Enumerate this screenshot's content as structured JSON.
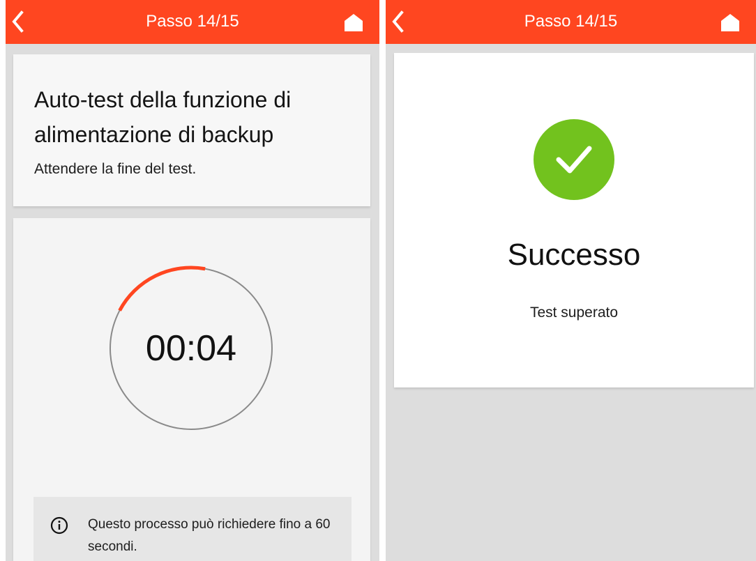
{
  "accent_color": "#ff4620",
  "success_color": "#72c21e",
  "left_screen": {
    "header": {
      "title": "Passo 14/15",
      "back_icon": "chevron-left-icon",
      "home_icon": "home-icon"
    },
    "title_card": {
      "heading": "Auto-test della funzione di alimentazione di backup",
      "subtitle": "Attendere la fine del test."
    },
    "timer": {
      "value": "00:04",
      "progress_fraction": 0.2
    },
    "info": {
      "icon": "info-icon",
      "text": "Questo processo può richiedere fino a 60 secondi."
    }
  },
  "right_screen": {
    "header": {
      "title": "Passo 14/15",
      "back_icon": "chevron-left-icon",
      "home_icon": "home-icon"
    },
    "result": {
      "icon": "check-circle-icon",
      "heading": "Successo",
      "text": "Test superato"
    }
  }
}
